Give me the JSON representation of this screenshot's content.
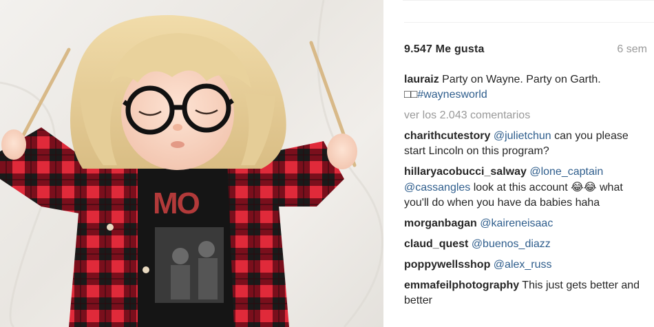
{
  "photo": {
    "alt_description_icon": "baby-photo",
    "band_text": "MO"
  },
  "post": {
    "likes": "9.547 Me gusta",
    "time_ago": "6 sem",
    "caption": {
      "user": "lauraiz",
      "text": " Party on Wayne. Party on Garth.",
      "boxes": "□□",
      "hashtag": "#waynesworld"
    },
    "view_all": "ver los 2.043 comentarios"
  },
  "comments": [
    {
      "user": "charithcutestory",
      "mention": "@julietchun",
      "text": " can you please start Lincoln on this program?"
    },
    {
      "user": "hillaryacobucci_salway",
      "mention": "@lone_captain",
      "mention2": "@cassangles",
      "text": " look at this account ",
      "emoji": "😂😂",
      "text2": " what you'll do when you have da babies haha"
    },
    {
      "user": "morganbagan",
      "mention": "@kaireneisaac",
      "text": ""
    },
    {
      "user": "claud_quest",
      "mention": "@buenos_diazz",
      "text": ""
    },
    {
      "user": "poppywellsshop",
      "mention": "@alex_russ",
      "text": ""
    },
    {
      "user": "emmafeilphotography",
      "mention": "",
      "text": " This just gets better and better"
    }
  ],
  "colors": {
    "link": "#2e5d8c",
    "muted": "#999999",
    "text": "#262626",
    "flannel_red": "#c8102e",
    "flannel_dark": "#1a1a1a"
  }
}
